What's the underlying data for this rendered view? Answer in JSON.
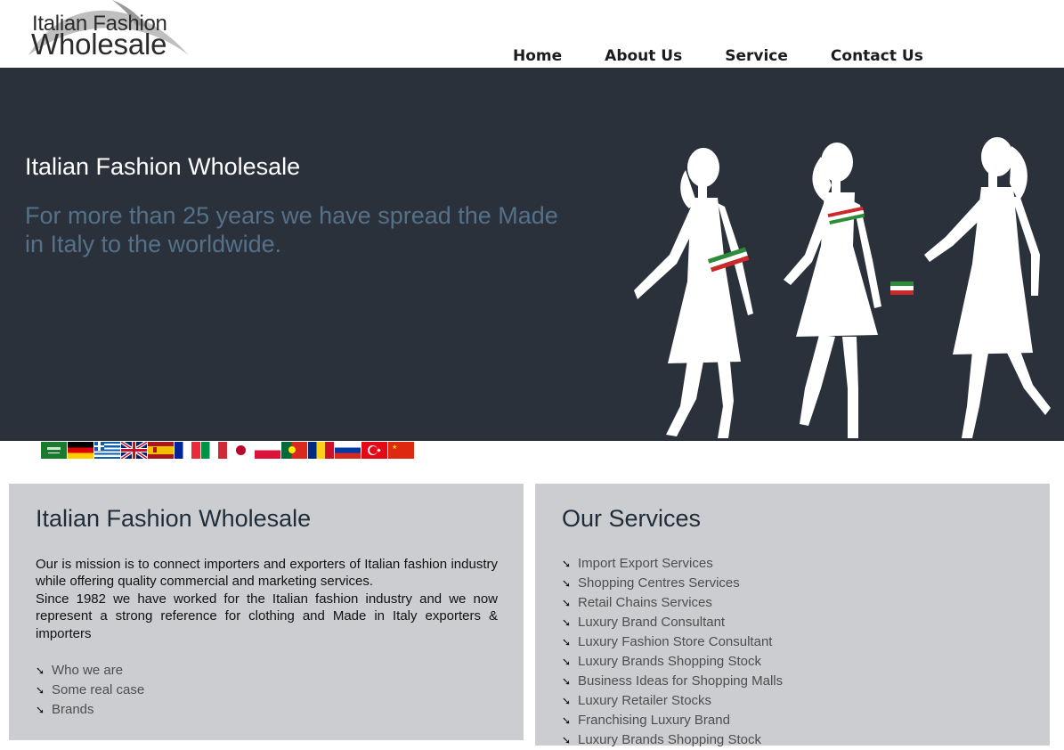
{
  "logo": {
    "line1": "Italian Fashion",
    "line2": "Wholesale"
  },
  "nav": {
    "items": [
      "Home",
      "About Us",
      "Service",
      "Contact Us"
    ]
  },
  "hero": {
    "title": "Italian Fashion Wholesale",
    "subtitle": "For more than 25 years we have spread the Made in Italy to the worldwide."
  },
  "flags": [
    "saudi-arabia",
    "germany",
    "greece",
    "united-kingdom",
    "spain",
    "france",
    "italy",
    "japan",
    "poland",
    "portugal",
    "romania",
    "russia",
    "turkey",
    "china"
  ],
  "left_panel": {
    "title": "Italian Fashion Wholesale",
    "mission": "Our is mission is to connect importers and exporters of Italian fashion industry while offering quality commercial and marketing services.",
    "since": "Since 1982 we have worked for the Italian fashion industry and we now represent a strong reference for clothing and Made in Italy exporters & importers",
    "links": [
      "Who we are",
      "Some real case",
      "Brands"
    ]
  },
  "right_panel": {
    "title": "Our Services",
    "links": [
      "Import Export Services",
      "Shopping Centres Services",
      "Retail Chains Services",
      "Luxury Brand Consultant",
      "Luxury Fashion Store Consultant",
      "Luxury Brands Shopping Stock",
      "Business Ideas for Shopping Malls",
      "Luxury Retailer Stocks",
      "Franchising Luxury Brand",
      "Luxury Brands Shopping Stock"
    ]
  },
  "colors": {
    "hero_bg": "#2b313b",
    "hero_subtitle": "#557189",
    "panel_bg": "#cbcdd0"
  }
}
